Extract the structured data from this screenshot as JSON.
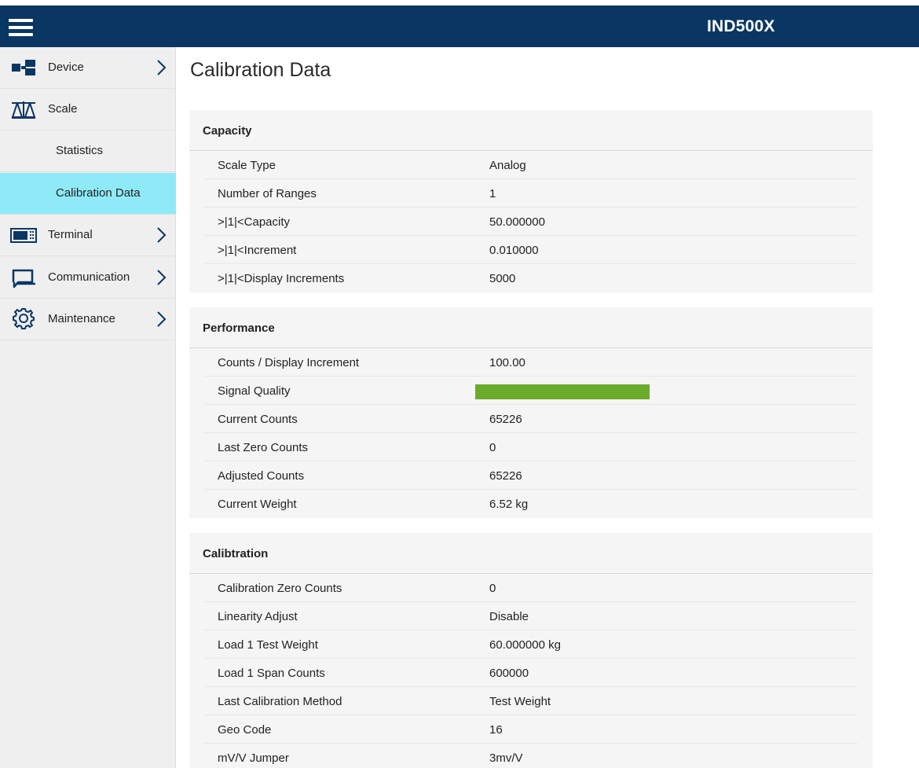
{
  "header": {
    "app_title": "IND500X"
  },
  "sidebar": {
    "items": [
      {
        "label": "Device",
        "icon": "device-icon"
      },
      {
        "label": "Scale",
        "icon": "scale-icon"
      },
      {
        "label": "Statistics"
      },
      {
        "label": "Calibration Data",
        "active": true
      },
      {
        "label": "Terminal",
        "icon": "terminal-icon"
      },
      {
        "label": "Communication",
        "icon": "communication-icon"
      },
      {
        "label": "Maintenance",
        "icon": "gear-icon"
      }
    ]
  },
  "main": {
    "title": "Calibration Data",
    "sections": [
      {
        "title": "Capacity",
        "rows": [
          {
            "key": "Scale Type",
            "value": "Analog"
          },
          {
            "key": "Number of Ranges",
            "value": "1"
          },
          {
            "key": ">|1|<Capacity",
            "value": "50.000000"
          },
          {
            "key": ">|1|<Increment",
            "value": "0.010000"
          },
          {
            "key": ">|1|<Display Increments",
            "value": "5000"
          }
        ]
      },
      {
        "title": "Performance",
        "rows": [
          {
            "key": "Counts / Display Increment",
            "value": "100.00"
          },
          {
            "key": "Signal Quality",
            "signal_quality_fraction": 1.0,
            "signal_color": "#6aab2a"
          },
          {
            "key": "Current Counts",
            "value": "65226"
          },
          {
            "key": "Last Zero Counts",
            "value": "0"
          },
          {
            "key": "Adjusted Counts",
            "value": "65226"
          },
          {
            "key": "Current Weight",
            "value": "6.52 kg"
          }
        ]
      },
      {
        "title": "Calibtration",
        "rows": [
          {
            "key": "Calibration Zero Counts",
            "value": "0"
          },
          {
            "key": "Linearity Adjust",
            "value": "Disable"
          },
          {
            "key": "Load 1 Test Weight",
            "value": "60.000000 kg"
          },
          {
            "key": "Load 1 Span Counts",
            "value": "600000"
          },
          {
            "key": "Last Calibration Method",
            "value": "Test Weight"
          },
          {
            "key": "Geo Code",
            "value": "16"
          },
          {
            "key": "mV/V Jumper",
            "value": "3mv/V"
          }
        ]
      }
    ]
  },
  "colors": {
    "header_bg": "#0a3664",
    "active_item_bg": "#8feaf7",
    "sidebar_bg": "#efefef",
    "panel_bg": "#f5f5f5"
  }
}
